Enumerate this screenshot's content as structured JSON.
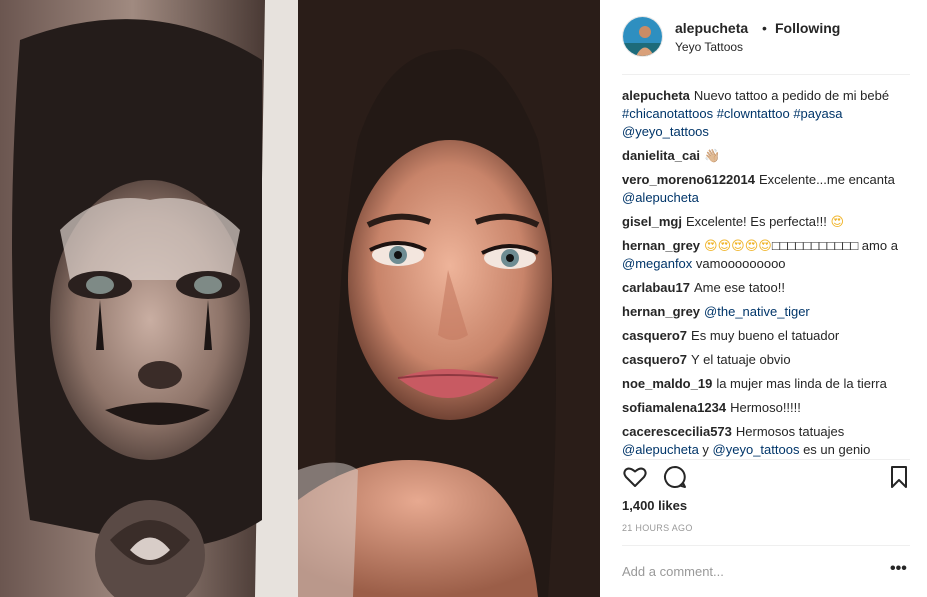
{
  "post": {
    "username": "alepucheta",
    "separator": "•",
    "follow_status": "Following",
    "location": "Yeyo Tattoos",
    "likes": "1,400 likes",
    "timestamp": "21 HOURS AGO",
    "comment_placeholder": "Add a comment...",
    "more_label": "•••"
  },
  "comments": [
    {
      "user": "alepucheta",
      "parts": [
        {
          "t": "Nuevo tattoo a pedido de mi bebé "
        },
        {
          "t": "#chicanotattoos",
          "tag": true
        },
        {
          "t": " "
        },
        {
          "t": "#clowntattoo",
          "tag": true
        },
        {
          "t": " "
        },
        {
          "t": "#payasa",
          "tag": true
        },
        {
          "t": " "
        },
        {
          "t": "@yeyo_tattoos",
          "tag": true
        }
      ]
    },
    {
      "user": "danielita_cai",
      "parts": [
        {
          "t": "👋🏼",
          "emoji": true
        }
      ]
    },
    {
      "user": "vero_moreno6122014",
      "parts": [
        {
          "t": "Excelente...me encanta "
        },
        {
          "t": "@alepucheta",
          "tag": true
        }
      ]
    },
    {
      "user": "gisel_mgj",
      "parts": [
        {
          "t": "Excelente! Es perfecta!!! "
        },
        {
          "t": "😍",
          "emoji": true
        }
      ]
    },
    {
      "user": "hernan_grey",
      "parts": [
        {
          "t": "😍😍😍😍😍",
          "emoji": true
        },
        {
          "t": "□□□□□□□□□□□ amo a "
        },
        {
          "t": "@meganfox",
          "tag": true
        },
        {
          "t": " vamooooooooo"
        }
      ]
    },
    {
      "user": "carlabau17",
      "parts": [
        {
          "t": "Ame ese tatoo!!"
        }
      ]
    },
    {
      "user": "hernan_grey",
      "parts": [
        {
          "t": "@the_native_tiger",
          "tag": true
        }
      ]
    },
    {
      "user": "casquero7",
      "parts": [
        {
          "t": "Es muy bueno el tatuador"
        }
      ]
    },
    {
      "user": "casquero7",
      "parts": [
        {
          "t": "Y el tatuaje obvio"
        }
      ]
    },
    {
      "user": "noe_maldo_19",
      "parts": [
        {
          "t": "la mujer mas linda de la tierra"
        }
      ]
    },
    {
      "user": "sofiamalena1234",
      "parts": [
        {
          "t": "Hermoso!!!!!"
        }
      ]
    },
    {
      "user": "cacerescecilia573",
      "parts": [
        {
          "t": "Hermosos tatuajes "
        },
        {
          "t": "@alepucheta",
          "tag": true
        },
        {
          "t": " y "
        },
        {
          "t": "@yeyo_tattoos",
          "tag": true
        },
        {
          "t": " es un genio"
        }
      ]
    }
  ],
  "icons": {
    "like": "heart-outline-icon",
    "comment": "speech-bubble-icon",
    "save": "bookmark-icon",
    "more": "ellipsis-icon"
  },
  "colors": {
    "tag": "#003569",
    "text": "#262626",
    "muted": "#999999",
    "divider": "#efefef"
  }
}
